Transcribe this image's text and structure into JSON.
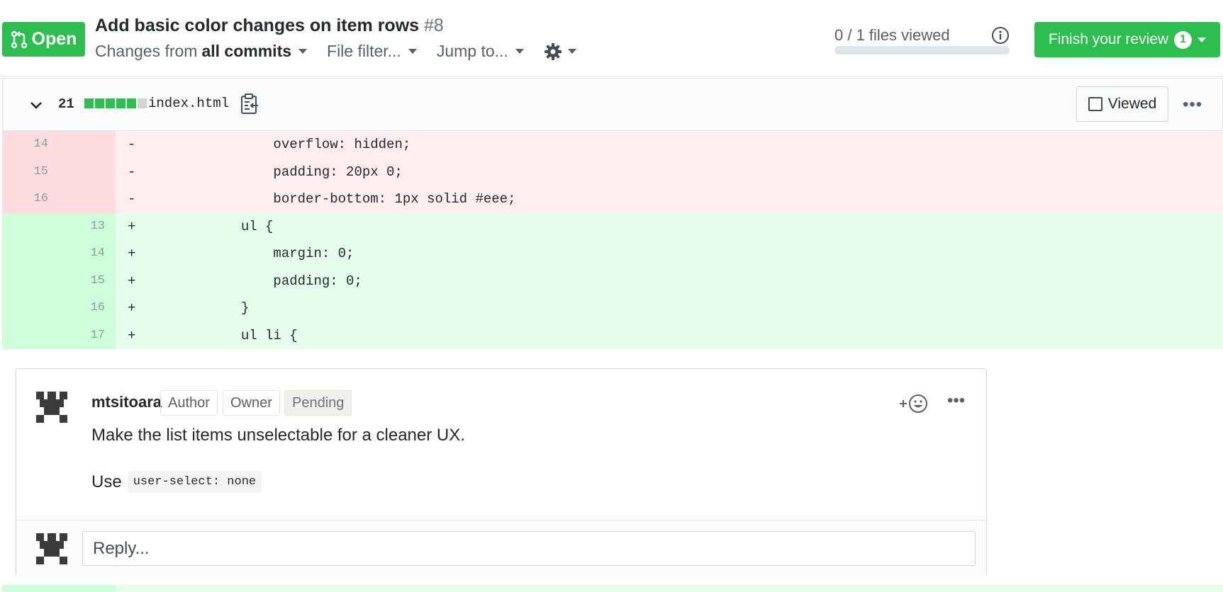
{
  "header": {
    "state_label": "Open",
    "title": "Add basic color changes on item rows",
    "number": "#8",
    "toolbar": {
      "changes_prefix": "Changes from",
      "changes_value": "all commits",
      "file_filter": "File filter...",
      "jump_to": "Jump to..."
    },
    "files_viewed": "0 / 1 files viewed",
    "files_viewed_progress": 0,
    "finish_review_label": "Finish your review",
    "pending_count": "1"
  },
  "file": {
    "change_count": "21",
    "diffstat": [
      "add",
      "add",
      "add",
      "add",
      "add",
      "neutral"
    ],
    "name": "index.html",
    "viewed_label": "Viewed"
  },
  "diff": {
    "deleted": [
      {
        "old": "14",
        "marker": "-",
        "code": "                overflow: hidden;"
      },
      {
        "old": "15",
        "marker": "-",
        "code": "                padding: 20px 0;"
      },
      {
        "old": "16",
        "marker": "-",
        "code": "                border-bottom: 1px solid #eee;"
      }
    ],
    "added": [
      {
        "new": "13",
        "marker": "+",
        "code": "            ul {"
      },
      {
        "new": "14",
        "marker": "+",
        "code": "                margin: 0;"
      },
      {
        "new": "15",
        "marker": "+",
        "code": "                padding: 0;"
      },
      {
        "new": "16",
        "marker": "+",
        "code": "            }"
      },
      {
        "new": "17",
        "marker": "+",
        "code": "            ul li {"
      }
    ]
  },
  "comment": {
    "author": "mtsitoara",
    "labels": [
      "Author",
      "Owner",
      "Pending"
    ],
    "text": "Make the list items unselectable for a cleaner UX.",
    "text2_prefix": "Use",
    "text2_code": "user-select: none",
    "reply_placeholder": "Reply..."
  },
  "colors": {
    "green": "#2cbe4e",
    "deletion_bg": "#ffeef0",
    "addition_bg": "#e6ffed"
  }
}
